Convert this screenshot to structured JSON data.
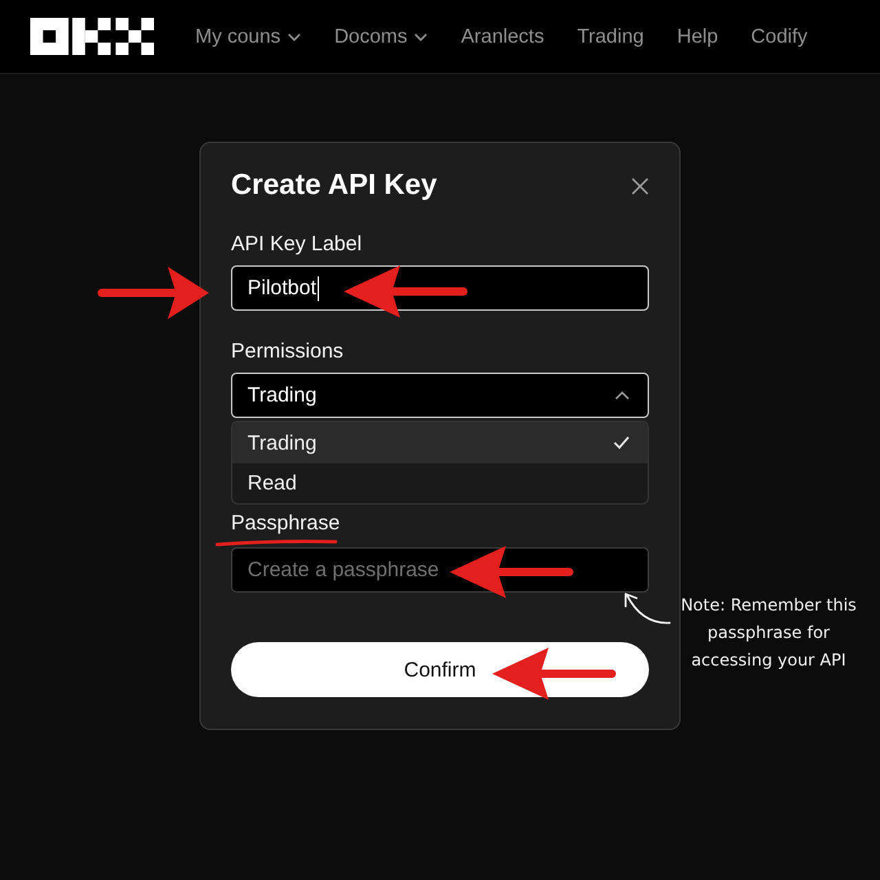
{
  "nav": {
    "items": [
      {
        "label": "My couns",
        "has_menu": true
      },
      {
        "label": "Docoms",
        "has_menu": true
      },
      {
        "label": "Aranlects",
        "has_menu": false
      },
      {
        "label": "Trading",
        "has_menu": false
      },
      {
        "label": "Help",
        "has_menu": false
      },
      {
        "label": "Codify",
        "has_menu": false
      }
    ]
  },
  "dialog": {
    "title": "Create API Key",
    "fields": [
      {
        "kind": "text",
        "label": "API Key Label",
        "value": "Pilotbot",
        "focused": true
      },
      {
        "kind": "select",
        "label": "Permissions",
        "value": "Trading",
        "expanded": true,
        "options": [
          {
            "label": "Trading",
            "selected": true
          },
          {
            "label": "Read",
            "selected": false
          }
        ]
      },
      {
        "kind": "text",
        "label": "Passphrase",
        "placeholder": "Create a passphrase",
        "focused": false
      }
    ],
    "confirm_button": "Confirm"
  },
  "annotation": {
    "note": "Note: Remember this passphrase for accessing your API"
  }
}
